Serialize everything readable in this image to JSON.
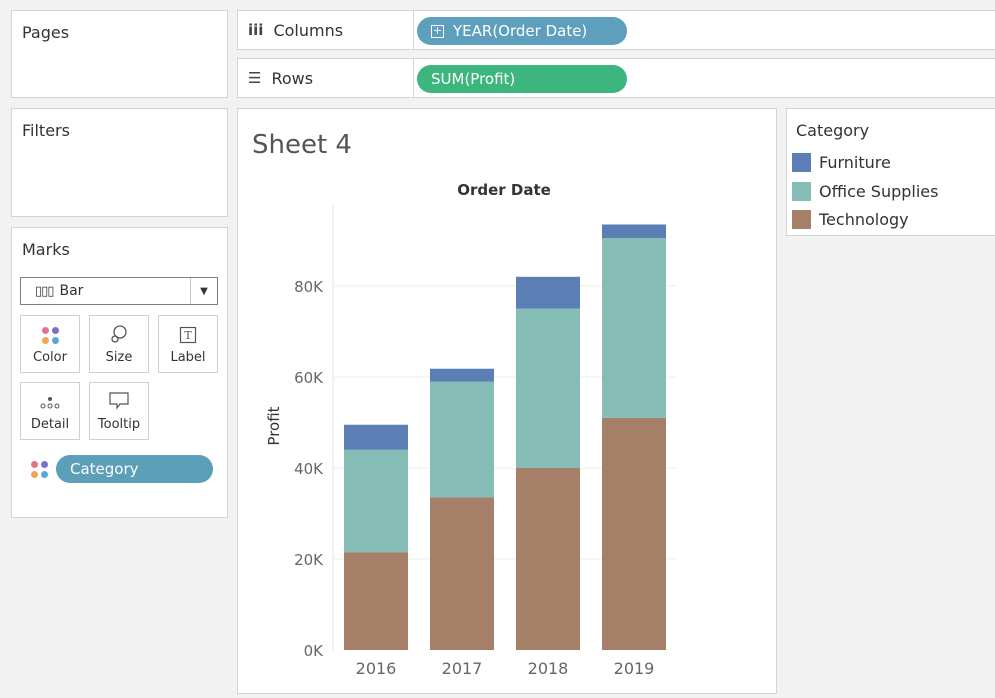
{
  "pages_panel": {
    "title": "Pages"
  },
  "filters_panel": {
    "title": "Filters"
  },
  "columns_shelf": {
    "label": "Columns",
    "icon": "columns-icon",
    "pill": "YEAR(Order Date)",
    "pill_color": "#5d9fbd"
  },
  "rows_shelf": {
    "label": "Rows",
    "icon": "rows-icon",
    "pill": "SUM(Profit)",
    "pill_color": "#3cb67e"
  },
  "marks_panel": {
    "title": "Marks",
    "mark_type": "Bar",
    "buttons": {
      "color": "Color",
      "size": "Size",
      "label": "Label",
      "detail": "Detail",
      "tooltip": "Tooltip"
    },
    "category_pill": "Category",
    "category_pill_color": "#5b9fb8"
  },
  "sheet": {
    "title": "Sheet 4"
  },
  "legend": {
    "title": "Category",
    "items": [
      {
        "label": "Furniture",
        "color": "#5b7fb4"
      },
      {
        "label": "Office Supplies",
        "color": "#86bcb6"
      },
      {
        "label": "Technology",
        "color": "#a57f68"
      }
    ]
  },
  "chart_data": {
    "type": "bar",
    "stacked": true,
    "title": "Order Date",
    "xlabel": "",
    "ylabel": "Profit",
    "categories": [
      "2016",
      "2017",
      "2018",
      "2019"
    ],
    "series": [
      {
        "name": "Technology",
        "color": "#a57f68",
        "values": [
          21500,
          33500,
          40000,
          51000
        ]
      },
      {
        "name": "Office Supplies",
        "color": "#86bcb6",
        "values": [
          22500,
          25500,
          35000,
          39500
        ]
      },
      {
        "name": "Furniture",
        "color": "#5b7fb4",
        "values": [
          5500,
          2800,
          7000,
          3000
        ]
      }
    ],
    "ylim": [
      0,
      98000
    ],
    "yticks": [
      0,
      20000,
      40000,
      60000,
      80000
    ],
    "ytick_labels": [
      "0K",
      "20K",
      "40K",
      "60K",
      "80K"
    ],
    "grid": true,
    "legend": "right"
  }
}
